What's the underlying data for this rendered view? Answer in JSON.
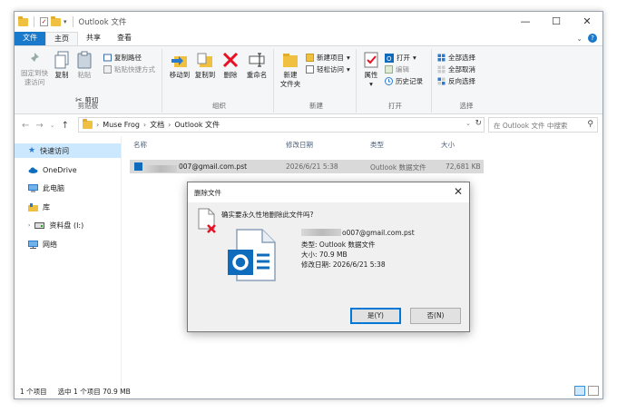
{
  "window": {
    "title": "Outlook 文件",
    "controls": [
      "—",
      "☐",
      "✕"
    ]
  },
  "ribbon_tabs": [
    "文件",
    "主页",
    "共享",
    "查看"
  ],
  "ribbon": {
    "clipboard": {
      "pin_label": "固定到快速访问",
      "copy_label": "复制",
      "paste_label": "粘贴",
      "copy_path_label": "复制路径",
      "paste_shortcut_label": "粘贴快捷方式",
      "cut_label": "剪切",
      "group_label": "剪贴板"
    },
    "organize": {
      "move_to_label": "移动到",
      "copy_to_label": "复制到",
      "delete_label": "删除",
      "rename_label": "重命名",
      "group_label": "组织"
    },
    "new": {
      "new_folder_label": "新建\n文件夹",
      "new_item_label": "新建项目",
      "easy_access_label": "轻松访问",
      "group_label": "新建"
    },
    "open": {
      "properties_label": "属性",
      "open_label": "打开",
      "edit_label": "编辑",
      "history_label": "历史记录",
      "group_label": "打开"
    },
    "select": {
      "select_all_label": "全部选择",
      "select_none_label": "全部取消",
      "invert_label": "反向选择",
      "group_label": "选择"
    }
  },
  "address": {
    "path": [
      "Muse Frog",
      "文档",
      "Outlook 文件"
    ],
    "search_placeholder": "在 Outlook 文件 中搜索"
  },
  "sidebar": {
    "items": [
      "快速访问",
      "OneDrive",
      "此电脑",
      "库",
      "资料盘 (I:)",
      "网络"
    ]
  },
  "file_list": {
    "columns": [
      "名称",
      "修改日期",
      "类型",
      "大小"
    ],
    "rows": [
      {
        "name": "007@gmail.com.pst",
        "date": "2026/6/21 5:38",
        "type": "Outlook 数据文件",
        "size": "72,681 KB"
      }
    ]
  },
  "status_bar": {
    "count": "1 个项目",
    "selected": "选中 1 个项目  70.9 MB"
  },
  "dialog": {
    "title": "删除文件",
    "question": "确实要永久性地删除此文件吗?",
    "file_name": "o007@gmail.com.pst",
    "file_type": "类型: Outlook 数据文件",
    "file_size": "大小: 70.9 MB",
    "file_date": "修改日期: 2026/6/21 5:38",
    "yes_label": "是(Y)",
    "no_label": "否(N)"
  },
  "colors": {
    "accent": "#1979ca",
    "selection": "#cce8ff",
    "outlook_blue": "#0f6cbd",
    "delete_red": "#e81123"
  }
}
